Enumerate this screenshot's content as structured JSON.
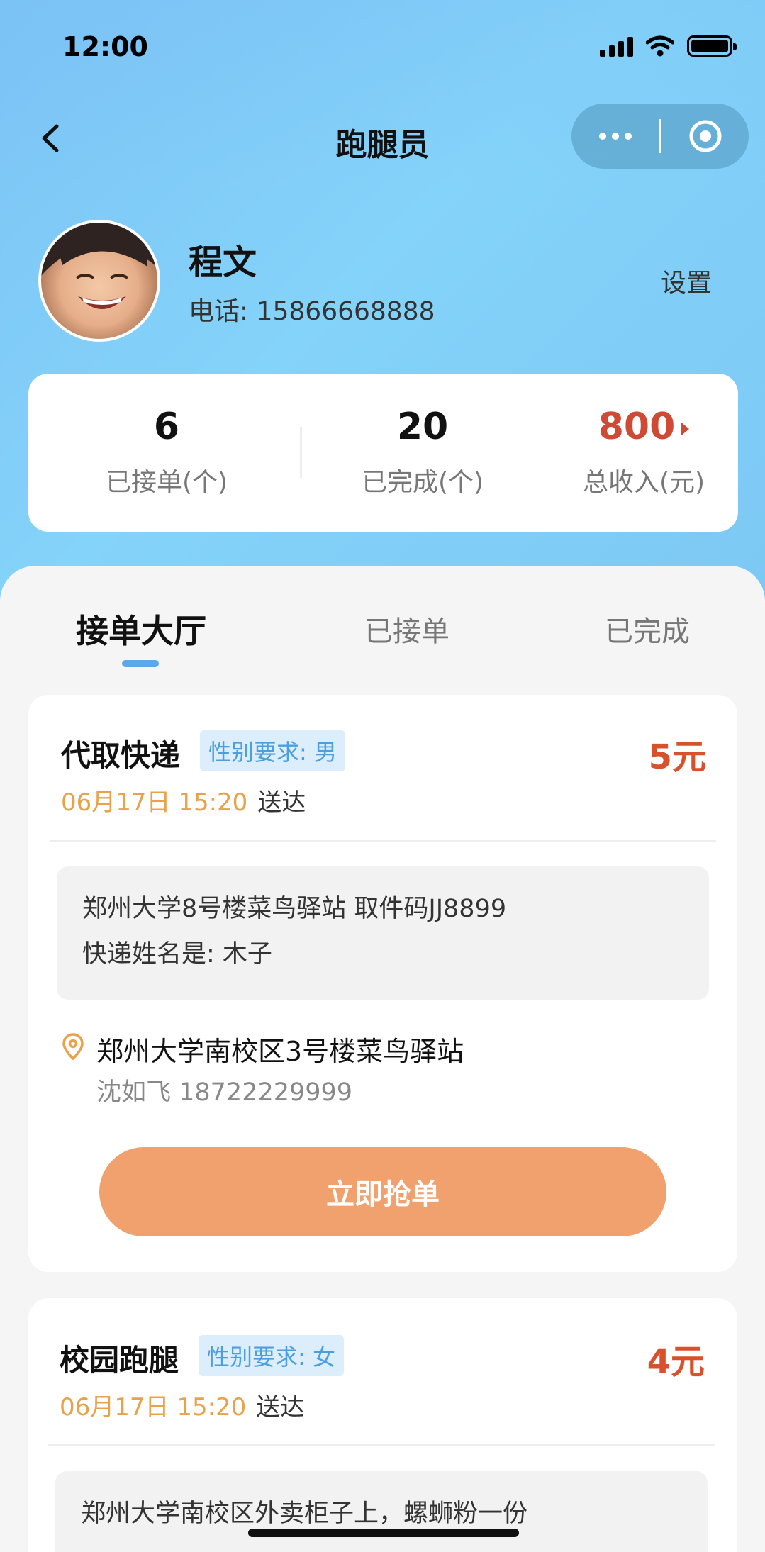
{
  "status_bar": {
    "time": "12:00"
  },
  "nav": {
    "title": "跑腿员"
  },
  "profile": {
    "name": "程文",
    "phone": "电话: 15866668888",
    "settings_label": "设置"
  },
  "stats": [
    {
      "value": "6",
      "label": "已接单(个)"
    },
    {
      "value": "20",
      "label": "已完成(个)"
    },
    {
      "value": "800",
      "label": "总收入(元)"
    }
  ],
  "tabs": [
    {
      "label": "接单大厅",
      "active": true
    },
    {
      "label": "已接单",
      "active": false
    },
    {
      "label": "已完成",
      "active": false
    }
  ],
  "orders": [
    {
      "title": "代取快递",
      "gender_tag": "性别要求: 男",
      "price": "5元",
      "time": "06月17日 15:20",
      "time_suffix": "送达",
      "note_lines": [
        "郑州大学8号楼菜鸟驿站 取件码JJ8899",
        "快递姓名是: 木子"
      ],
      "address": "郑州大学南校区3号楼菜鸟驿站",
      "contact": "沈如飞 18722229999",
      "button_label": "立即抢单"
    },
    {
      "title": "校园跑腿",
      "gender_tag": "性别要求: 女",
      "price": "4元",
      "time": "06月17日 15:20",
      "time_suffix": "送达",
      "note_lines": [
        "郑州大学南校区外卖柜子上，螺蛳粉一份"
      ]
    }
  ],
  "colors": {
    "accent_blue": "#5aa8ea",
    "price_red": "#d8512d",
    "time_orange": "#e8a24a",
    "button_orange": "#f0a16e"
  }
}
